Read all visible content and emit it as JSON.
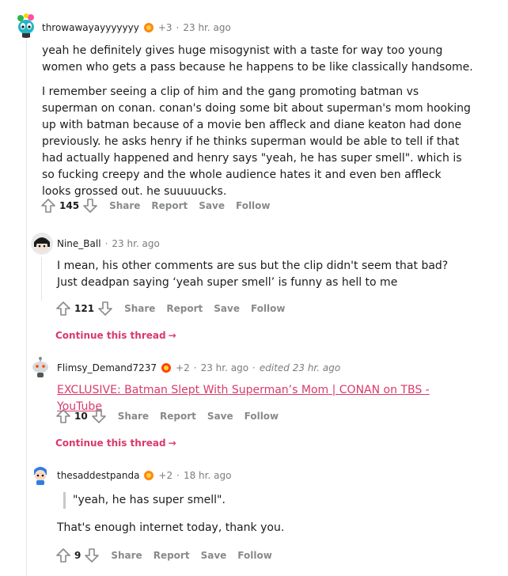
{
  "comments": [
    {
      "username": "throwawayayyyyyyy",
      "awards_extra": "+3",
      "time": "23 hr. ago",
      "paragraphs": [
        "yeah he definitely gives huge misogynist with a taste for way too young women who gets a pass because he happens to be like classically handsome.",
        "I remember seeing a clip of him and the gang promoting batman vs superman on conan. conan's doing some bit about superman's mom hooking up with batman because of a movie ben affleck and diane keaton had done previously. he asks henry if he thinks superman would be able to tell if that had actually happened and henry says \"yeah, he has super smell\". which is so fucking creepy and the whole audience hates it and even ben affleck looks grossed out. he suuuuucks."
      ],
      "score": "145"
    },
    {
      "username": "Nine_Ball",
      "time": "23 hr. ago",
      "text": "I mean, his other comments are sus but the clip didn't seem that bad? Just deadpan saying ‘yeah super smell’ is funny as hell to me",
      "score": "121"
    },
    {
      "username": "Flimsy_Demand7237",
      "awards_extra": "+2",
      "time": "23 hr. ago",
      "edited": "edited 23 hr. ago",
      "link_text": "EXCLUSIVE: Batman Slept With Superman’s Mom | CONAN on TBS - YouTube",
      "score": "10"
    },
    {
      "username": "thesaddestpanda",
      "awards_extra": "+2",
      "time": "18 hr. ago",
      "quote": "\"yeah, he has super smell\".",
      "text": "That's enough internet today, thank you.",
      "score": "9"
    }
  ],
  "actions": {
    "share": "Share",
    "report": "Report",
    "save": "Save",
    "follow": "Follow"
  },
  "continue_label": "Continue this thread",
  "separator": "·",
  "colors": {
    "link": "#d93a6b",
    "meta": "#7c7c7c",
    "action": "#878a8c"
  }
}
